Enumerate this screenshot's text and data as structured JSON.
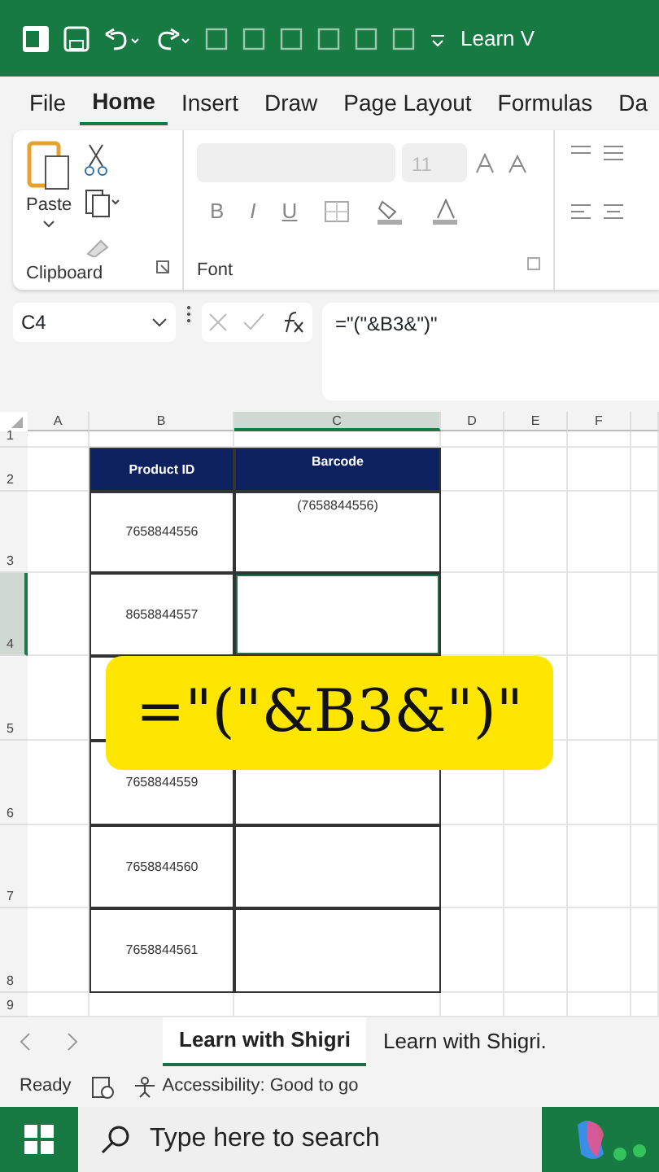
{
  "title_bar": {
    "title": "Learn V"
  },
  "ribbon_tabs": [
    {
      "label": "File",
      "selected": false
    },
    {
      "label": "Home",
      "selected": true
    },
    {
      "label": "Insert",
      "selected": false
    },
    {
      "label": "Draw",
      "selected": false
    },
    {
      "label": "Page Layout",
      "selected": false
    },
    {
      "label": "Formulas",
      "selected": false
    },
    {
      "label": "Da",
      "selected": false
    }
  ],
  "ribbon": {
    "clipboard": {
      "paste_label": "Paste",
      "group_label": "Clipboard"
    },
    "font": {
      "font_size": "11",
      "group_label": "Font",
      "bold": "B",
      "italic": "I",
      "underline": "U"
    }
  },
  "formula_bar": {
    "name_box": "C4",
    "formula": "=\"(\"&B3&\")\""
  },
  "columns": [
    {
      "label": "A",
      "selected": false
    },
    {
      "label": "B",
      "selected": false
    },
    {
      "label": "C",
      "selected": true
    },
    {
      "label": "D",
      "selected": false
    },
    {
      "label": "E",
      "selected": false
    },
    {
      "label": "F",
      "selected": false
    }
  ],
  "rows": [
    {
      "number": "1",
      "kind": "blank",
      "selected": false
    },
    {
      "number": "2",
      "kind": "header",
      "product_id": "Product ID",
      "barcode": "Barcode",
      "selected": false
    },
    {
      "number": "3",
      "kind": "data",
      "product_id": "7658844556",
      "barcode": "(7658844556)",
      "selected": false
    },
    {
      "number": "4",
      "kind": "data",
      "product_id": "8658844557",
      "selected": true
    },
    {
      "number": "5",
      "kind": "data",
      "selected": false
    },
    {
      "number": "6",
      "kind": "data",
      "product_id": "7658844559",
      "selected": false
    },
    {
      "number": "7",
      "kind": "data",
      "product_id": "7658844560",
      "selected": false
    },
    {
      "number": "8",
      "kind": "data",
      "product_id": "7658844561",
      "selected": false
    },
    {
      "number": "9",
      "kind": "blank",
      "selected": false
    }
  ],
  "caption_overlay": {
    "text": "=\"(\"&B3&\")\""
  },
  "sheet_tabs": [
    {
      "label": "Learn with Shigri",
      "selected": true
    },
    {
      "label": "Learn with Shigri.",
      "selected": false
    }
  ],
  "status_bar": {
    "mode": "Ready",
    "accessibility": "Accessibility: Good to go"
  },
  "taskbar": {
    "search_placeholder": "Type here to search"
  }
}
